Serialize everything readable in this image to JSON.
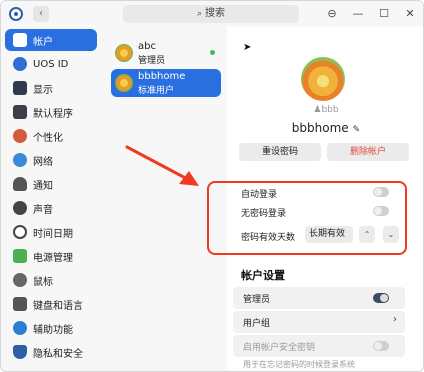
{
  "titlebar": {
    "search_placeholder": "搜索",
    "back_glyph": "‹",
    "menu_glyph": "⊖",
    "minimize_glyph": "—",
    "maximize_glyph": "☐",
    "close_glyph": "✕"
  },
  "sidebar": {
    "items": [
      {
        "label": "帐户",
        "icon": "account-icon",
        "color": "#ffffff",
        "active": true
      },
      {
        "label": "UOS ID",
        "icon": "cloud-icon",
        "color": "#2d6fd6"
      },
      {
        "label": "显示",
        "icon": "display-icon",
        "color": "#2f3b4c"
      },
      {
        "label": "默认程序",
        "icon": "default-apps-icon",
        "color": "#3a3f4a"
      },
      {
        "label": "个性化",
        "icon": "personalization-icon",
        "color": "#d65a3a"
      },
      {
        "label": "网络",
        "icon": "network-icon",
        "color": "#3a8ad6"
      },
      {
        "label": "通知",
        "icon": "bell-icon",
        "color": "#555555"
      },
      {
        "label": "声音",
        "icon": "sound-icon",
        "color": "#444444"
      },
      {
        "label": "时间日期",
        "icon": "clock-icon",
        "color": "#444444"
      },
      {
        "label": "电源管理",
        "icon": "battery-icon",
        "color": "#4caf50"
      },
      {
        "label": "鼠标",
        "icon": "mouse-icon",
        "color": "#666666"
      },
      {
        "label": "键盘和语言",
        "icon": "keyboard-icon",
        "color": "#555555"
      },
      {
        "label": "辅助功能",
        "icon": "accessibility-icon",
        "color": "#2d7fd6"
      },
      {
        "label": "隐私和安全",
        "icon": "shield-icon",
        "color": "#2d5fa6"
      }
    ]
  },
  "users": [
    {
      "name": "abc",
      "role": "管理员",
      "online": true,
      "active": false
    },
    {
      "name": "bbbhome",
      "role": "标准用户",
      "online": false,
      "active": true
    }
  ],
  "detail": {
    "short_name": "bbb",
    "full_name": "bbbhome",
    "reset_password_label": "重设密码",
    "delete_account_label": "删除帐户",
    "auto_login_label": "自动登录",
    "auto_login_on": false,
    "nopass_login_label": "无密码登录",
    "nopass_login_on": false,
    "password_validity_label": "密码有效天数",
    "password_validity_value": "长期有效",
    "account_settings_title": "帐户设置",
    "admin_label": "管理员",
    "admin_on": true,
    "usergroup_label": "用户组",
    "security_key_label": "启用帐户安全密钥",
    "security_key_hint": "用于在忘记密码的时候登录系统"
  },
  "colors": {
    "accent": "#2a6fe0",
    "delete_text": "#e04a3a",
    "annotation": "#f03a22"
  }
}
